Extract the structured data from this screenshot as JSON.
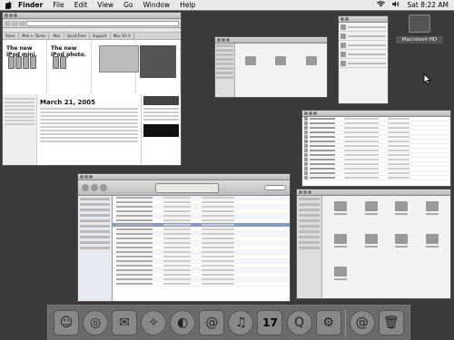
{
  "menubar": {
    "apple": "",
    "items": [
      "Finder",
      "File",
      "Edit",
      "View",
      "Go",
      "Window",
      "Help"
    ],
    "clock": "Sat 8:22 AM",
    "wifi": "wifi-icon",
    "volume": "volume-icon"
  },
  "desktop": {
    "hd_label": "Macintosh HD"
  },
  "safari": {
    "nav_tabs": [
      "Store",
      "iPod + iTunes",
      ".Mac",
      "QuickTime",
      "Support",
      "Mac OS X"
    ],
    "hero_headline_1": "The new iPod mini.",
    "hero_headline_2": "The new iPod photo.",
    "date_heading": "March 21, 2005"
  },
  "dock": {
    "icons": [
      "finder-icon",
      "dashboard-icon",
      "mail-icon",
      "safari-icon",
      "ichat-icon",
      "address-book-icon",
      "itunes-icon",
      "ical-icon",
      "quicktime-icon",
      "system-preferences-icon",
      "internet-connect-icon",
      "trash-icon"
    ],
    "ical_day": "17"
  }
}
